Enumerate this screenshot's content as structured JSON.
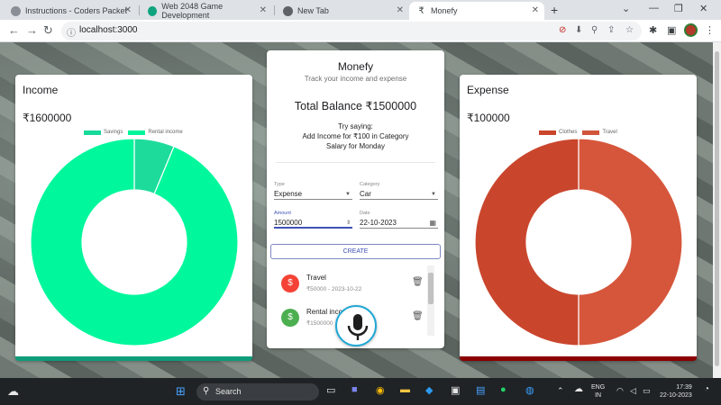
{
  "browser": {
    "tabs": [
      {
        "title": "Instructions - Coders Packet",
        "active": false
      },
      {
        "title": "Web 2048 Game Development",
        "active": false
      },
      {
        "title": "New Tab",
        "active": false
      },
      {
        "title": "Monefy",
        "active": true
      }
    ],
    "url": "localhost:3000"
  },
  "income": {
    "title": "Income",
    "total": "₹1600000",
    "legend": [
      {
        "label": "Savings",
        "color": "#17d99a"
      },
      {
        "label": "Rental income",
        "color": "#00f59b"
      }
    ],
    "chart_data": {
      "type": "pie",
      "categories": [
        "Savings",
        "Rental income"
      ],
      "values": [
        100000,
        1500000
      ],
      "colors": [
        "#1ddc9b",
        "#00f79c"
      ]
    }
  },
  "expense": {
    "title": "Expense",
    "total": "₹100000",
    "legend": [
      {
        "label": "Clothes",
        "color": "#c9452b"
      },
      {
        "label": "Travel",
        "color": "#d0553a"
      }
    ],
    "chart_data": {
      "type": "pie",
      "categories": [
        "Clothes",
        "Travel"
      ],
      "values": [
        50000,
        50000
      ],
      "colors": [
        "#d6563b",
        "#c9462d"
      ]
    }
  },
  "main": {
    "title": "Monefy",
    "subtitle": "Track your income and expense",
    "balance": "Total Balance ₹1500000",
    "hint": [
      "Try saying:",
      "Add Income for ₹100 in Category",
      "Salary for Monday"
    ],
    "form": {
      "type_label": "Type",
      "type_value": "Expense",
      "category_label": "Category",
      "category_value": "Car",
      "amount_label": "Amount",
      "amount_value": "1500000",
      "date_label": "Date",
      "date_value": "22-10-2023",
      "create_label": "CREATE"
    },
    "transactions": [
      {
        "name": "Travel",
        "meta": "₹50000 - 2023-10-22",
        "kind": "expense",
        "color": "#f44336"
      },
      {
        "name": "Rental inco",
        "meta": "₹1500000",
        "kind": "income",
        "color": "#4caf50"
      }
    ]
  },
  "taskbar": {
    "search_label": "Search",
    "lang": "ENG",
    "region": "IN",
    "time": "17:39",
    "date": "22-10-2023"
  }
}
